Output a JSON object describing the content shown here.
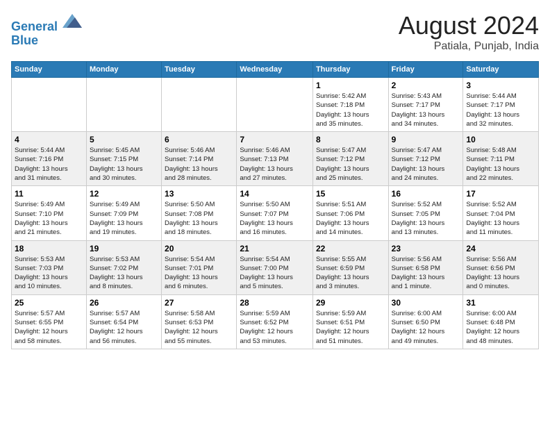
{
  "logo": {
    "line1": "General",
    "line2": "Blue"
  },
  "title": "August 2024",
  "location": "Patiala, Punjab, India",
  "days_of_week": [
    "Sunday",
    "Monday",
    "Tuesday",
    "Wednesday",
    "Thursday",
    "Friday",
    "Saturday"
  ],
  "weeks": [
    [
      {
        "day": "",
        "info": ""
      },
      {
        "day": "",
        "info": ""
      },
      {
        "day": "",
        "info": ""
      },
      {
        "day": "",
        "info": ""
      },
      {
        "day": "1",
        "info": "Sunrise: 5:42 AM\nSunset: 7:18 PM\nDaylight: 13 hours\nand 35 minutes."
      },
      {
        "day": "2",
        "info": "Sunrise: 5:43 AM\nSunset: 7:17 PM\nDaylight: 13 hours\nand 34 minutes."
      },
      {
        "day": "3",
        "info": "Sunrise: 5:44 AM\nSunset: 7:17 PM\nDaylight: 13 hours\nand 32 minutes."
      }
    ],
    [
      {
        "day": "4",
        "info": "Sunrise: 5:44 AM\nSunset: 7:16 PM\nDaylight: 13 hours\nand 31 minutes."
      },
      {
        "day": "5",
        "info": "Sunrise: 5:45 AM\nSunset: 7:15 PM\nDaylight: 13 hours\nand 30 minutes."
      },
      {
        "day": "6",
        "info": "Sunrise: 5:46 AM\nSunset: 7:14 PM\nDaylight: 13 hours\nand 28 minutes."
      },
      {
        "day": "7",
        "info": "Sunrise: 5:46 AM\nSunset: 7:13 PM\nDaylight: 13 hours\nand 27 minutes."
      },
      {
        "day": "8",
        "info": "Sunrise: 5:47 AM\nSunset: 7:12 PM\nDaylight: 13 hours\nand 25 minutes."
      },
      {
        "day": "9",
        "info": "Sunrise: 5:47 AM\nSunset: 7:12 PM\nDaylight: 13 hours\nand 24 minutes."
      },
      {
        "day": "10",
        "info": "Sunrise: 5:48 AM\nSunset: 7:11 PM\nDaylight: 13 hours\nand 22 minutes."
      }
    ],
    [
      {
        "day": "11",
        "info": "Sunrise: 5:49 AM\nSunset: 7:10 PM\nDaylight: 13 hours\nand 21 minutes."
      },
      {
        "day": "12",
        "info": "Sunrise: 5:49 AM\nSunset: 7:09 PM\nDaylight: 13 hours\nand 19 minutes."
      },
      {
        "day": "13",
        "info": "Sunrise: 5:50 AM\nSunset: 7:08 PM\nDaylight: 13 hours\nand 18 minutes."
      },
      {
        "day": "14",
        "info": "Sunrise: 5:50 AM\nSunset: 7:07 PM\nDaylight: 13 hours\nand 16 minutes."
      },
      {
        "day": "15",
        "info": "Sunrise: 5:51 AM\nSunset: 7:06 PM\nDaylight: 13 hours\nand 14 minutes."
      },
      {
        "day": "16",
        "info": "Sunrise: 5:52 AM\nSunset: 7:05 PM\nDaylight: 13 hours\nand 13 minutes."
      },
      {
        "day": "17",
        "info": "Sunrise: 5:52 AM\nSunset: 7:04 PM\nDaylight: 13 hours\nand 11 minutes."
      }
    ],
    [
      {
        "day": "18",
        "info": "Sunrise: 5:53 AM\nSunset: 7:03 PM\nDaylight: 13 hours\nand 10 minutes."
      },
      {
        "day": "19",
        "info": "Sunrise: 5:53 AM\nSunset: 7:02 PM\nDaylight: 13 hours\nand 8 minutes."
      },
      {
        "day": "20",
        "info": "Sunrise: 5:54 AM\nSunset: 7:01 PM\nDaylight: 13 hours\nand 6 minutes."
      },
      {
        "day": "21",
        "info": "Sunrise: 5:54 AM\nSunset: 7:00 PM\nDaylight: 13 hours\nand 5 minutes."
      },
      {
        "day": "22",
        "info": "Sunrise: 5:55 AM\nSunset: 6:59 PM\nDaylight: 13 hours\nand 3 minutes."
      },
      {
        "day": "23",
        "info": "Sunrise: 5:56 AM\nSunset: 6:58 PM\nDaylight: 13 hours\nand 1 minute."
      },
      {
        "day": "24",
        "info": "Sunrise: 5:56 AM\nSunset: 6:56 PM\nDaylight: 13 hours\nand 0 minutes."
      }
    ],
    [
      {
        "day": "25",
        "info": "Sunrise: 5:57 AM\nSunset: 6:55 PM\nDaylight: 12 hours\nand 58 minutes."
      },
      {
        "day": "26",
        "info": "Sunrise: 5:57 AM\nSunset: 6:54 PM\nDaylight: 12 hours\nand 56 minutes."
      },
      {
        "day": "27",
        "info": "Sunrise: 5:58 AM\nSunset: 6:53 PM\nDaylight: 12 hours\nand 55 minutes."
      },
      {
        "day": "28",
        "info": "Sunrise: 5:59 AM\nSunset: 6:52 PM\nDaylight: 12 hours\nand 53 minutes."
      },
      {
        "day": "29",
        "info": "Sunrise: 5:59 AM\nSunset: 6:51 PM\nDaylight: 12 hours\nand 51 minutes."
      },
      {
        "day": "30",
        "info": "Sunrise: 6:00 AM\nSunset: 6:50 PM\nDaylight: 12 hours\nand 49 minutes."
      },
      {
        "day": "31",
        "info": "Sunrise: 6:00 AM\nSunset: 6:48 PM\nDaylight: 12 hours\nand 48 minutes."
      }
    ]
  ]
}
